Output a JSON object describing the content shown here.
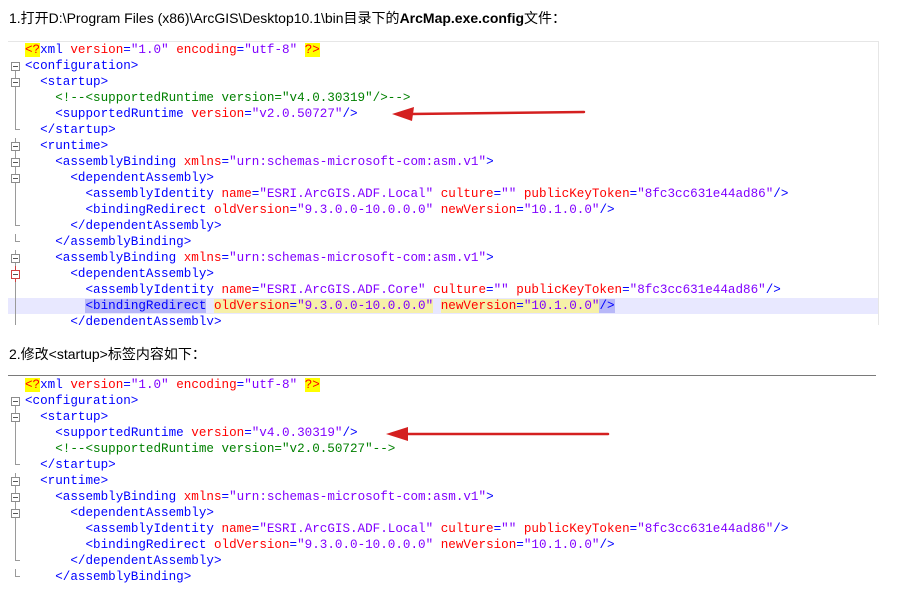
{
  "section1": {
    "prefix": "1.打开D:\\Program Files (x86)\\ArcGIS\\Desktop10.1\\bin目录下的",
    "bold": "ArcMap.exe.config",
    "suffix": "文件："
  },
  "section2": {
    "heading": "2.修改<startup>标签内容如下："
  },
  "code1": [
    {
      "indent": "",
      "kind": "pi",
      "pi_open": "<?",
      "name": "xml",
      "attrs": [
        {
          "n": "version",
          "v": "\"1.0\""
        },
        {
          "n": "encoding",
          "v": "\"utf-8\""
        }
      ],
      "pi_close": "?>"
    },
    {
      "indent": "",
      "kind": "tag",
      "text": "<configuration>"
    },
    {
      "indent": "  ",
      "kind": "tag",
      "text": "<startup>"
    },
    {
      "indent": "    ",
      "kind": "comment",
      "text": "<!--<supportedRuntime version=\"v4.0.30319\"/>-->"
    },
    {
      "indent": "    ",
      "kind": "element",
      "name": "supportedRuntime",
      "attrs": [
        {
          "n": "version",
          "v": "\"v2.0.50727\""
        }
      ],
      "close": "/>"
    },
    {
      "indent": "  ",
      "kind": "tag",
      "text": "</startup>"
    },
    {
      "indent": "  ",
      "kind": "tag",
      "text": "<runtime>"
    },
    {
      "indent": "    ",
      "kind": "element",
      "name": "assemblyBinding",
      "attrs": [
        {
          "n": "xmlns",
          "v": "\"urn:schemas-microsoft-com:asm.v1\""
        }
      ],
      "close": ">"
    },
    {
      "indent": "      ",
      "kind": "tag",
      "text": "<dependentAssembly>"
    },
    {
      "indent": "        ",
      "kind": "element",
      "name": "assemblyIdentity",
      "attrs": [
        {
          "n": "name",
          "v": "\"ESRI.ArcGIS.ADF.Local\""
        },
        {
          "n": "culture",
          "v": "\"\""
        },
        {
          "n": "publicKeyToken",
          "v": "\"8fc3cc631e44ad86\""
        }
      ],
      "close": "/>"
    },
    {
      "indent": "        ",
      "kind": "element",
      "name": "bindingRedirect",
      "attrs": [
        {
          "n": "oldVersion",
          "v": "\"9.3.0.0-10.0.0.0\""
        },
        {
          "n": "newVersion",
          "v": "\"10.1.0.0\""
        }
      ],
      "close": "/>"
    },
    {
      "indent": "      ",
      "kind": "tag",
      "text": "</dependentAssembly>"
    },
    {
      "indent": "    ",
      "kind": "tag",
      "text": "</assemblyBinding>"
    },
    {
      "indent": "    ",
      "kind": "element",
      "name": "assemblyBinding",
      "attrs": [
        {
          "n": "xmlns",
          "v": "\"urn:schemas-microsoft-com:asm.v1\""
        }
      ],
      "close": ">"
    },
    {
      "indent": "      ",
      "kind": "tag",
      "text": "<dependentAssembly>"
    },
    {
      "indent": "        ",
      "kind": "element",
      "name": "assemblyIdentity",
      "attrs": [
        {
          "n": "name",
          "v": "\"ESRI.ArcGIS.ADF.Core\""
        },
        {
          "n": "culture",
          "v": "\"\""
        },
        {
          "n": "publicKeyToken",
          "v": "\"8fc3cc631e44ad86\""
        }
      ],
      "close": "/>"
    },
    {
      "indent": "        ",
      "kind": "element",
      "name": "bindingRedirect",
      "attrs": [
        {
          "n": "oldVersion",
          "v": "\"9.3.0.0-10.0.0.0\""
        },
        {
          "n": "newVersion",
          "v": "\"10.1.0.0\""
        }
      ],
      "close": "/>",
      "highlight": true
    },
    {
      "indent": "      ",
      "kind": "tag",
      "text": "</dependentAssembly>"
    }
  ],
  "code2": [
    {
      "indent": "",
      "kind": "pi",
      "pi_open": "<?",
      "name": "xml",
      "attrs": [
        {
          "n": "version",
          "v": "\"1.0\""
        },
        {
          "n": "encoding",
          "v": "\"utf-8\""
        }
      ],
      "pi_close": "?>"
    },
    {
      "indent": "",
      "kind": "tag",
      "text": "<configuration>"
    },
    {
      "indent": "  ",
      "kind": "tag",
      "text": "<startup>"
    },
    {
      "indent": "    ",
      "kind": "element",
      "name": "supportedRuntime",
      "attrs": [
        {
          "n": "version",
          "v": "\"v4.0.30319\""
        }
      ],
      "close": "/>"
    },
    {
      "indent": "    ",
      "kind": "comment",
      "text": "<!--<supportedRuntime version=\"v2.0.50727\"-->"
    },
    {
      "indent": "  ",
      "kind": "tag",
      "text": "</startup>"
    },
    {
      "indent": "  ",
      "kind": "tag",
      "text": "<runtime>"
    },
    {
      "indent": "    ",
      "kind": "element",
      "name": "assemblyBinding",
      "attrs": [
        {
          "n": "xmlns",
          "v": "\"urn:schemas-microsoft-com:asm.v1\""
        }
      ],
      "close": ">"
    },
    {
      "indent": "      ",
      "kind": "tag",
      "text": "<dependentAssembly>"
    },
    {
      "indent": "        ",
      "kind": "element",
      "name": "assemblyIdentity",
      "attrs": [
        {
          "n": "name",
          "v": "\"ESRI.ArcGIS.ADF.Local\""
        },
        {
          "n": "culture",
          "v": "\"\""
        },
        {
          "n": "publicKeyToken",
          "v": "\"8fc3cc631e44ad86\""
        }
      ],
      "close": "/>"
    },
    {
      "indent": "        ",
      "kind": "element",
      "name": "bindingRedirect",
      "attrs": [
        {
          "n": "oldVersion",
          "v": "\"9.3.0.0-10.0.0.0\""
        },
        {
          "n": "newVersion",
          "v": "\"10.1.0.0\""
        }
      ],
      "close": "/>"
    },
    {
      "indent": "      ",
      "kind": "tag",
      "text": "</dependentAssembly>"
    },
    {
      "indent": "    ",
      "kind": "tag",
      "text": "</assemblyBinding>"
    }
  ],
  "colors": {
    "tag": "#0000ff",
    "attribute": "#ff0000",
    "value": "#8000ff",
    "comment": "#008000",
    "arrow": "#d42020",
    "current_line": "#e8e8ff"
  }
}
